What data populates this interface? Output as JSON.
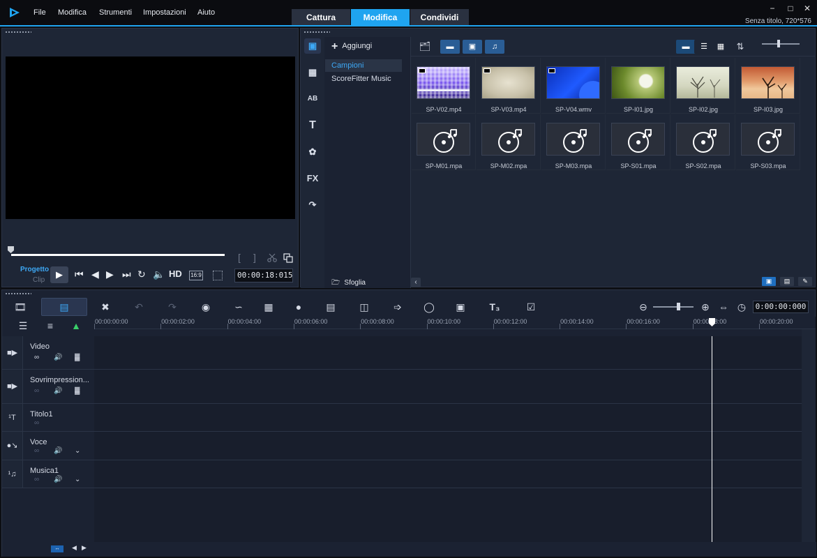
{
  "menu": {
    "items": [
      "File",
      "Modifica",
      "Strumenti",
      "Impostazioni",
      "Aiuto"
    ]
  },
  "tabs": [
    {
      "label": "Cattura",
      "active": false
    },
    {
      "label": "Modifica",
      "active": true
    },
    {
      "label": "Condividi",
      "active": false
    }
  ],
  "window": {
    "minimize": "−",
    "maximize": "□",
    "close": "✕",
    "project_title": "Senza titolo, 720*576"
  },
  "preview": {
    "mode_project": "Progetto",
    "mode_clip": "Clip",
    "timecode": "00:00:18:015",
    "hd_label": "HD",
    "aspect_label": "16:9",
    "mark_in": "[",
    "mark_out": "]"
  },
  "library": {
    "add_label": "Aggiungi",
    "folders": [
      {
        "label": "Campioni",
        "active": true
      },
      {
        "label": "ScoreFitter Music",
        "active": false
      }
    ],
    "browse_label": "Sfoglia",
    "sidebar_icons": [
      "media-icon",
      "instant-project-icon",
      "transition-icon",
      "title-icon",
      "graphics-icon",
      "fx-icon",
      "path-icon"
    ],
    "items": [
      {
        "name": "SP-V02.mp4",
        "kind": "video",
        "thumb": "purple-tiles"
      },
      {
        "name": "SP-V03.mp4",
        "kind": "video",
        "thumb": "beige"
      },
      {
        "name": "SP-V04.wmv",
        "kind": "video",
        "thumb": "blue"
      },
      {
        "name": "SP-I01.jpg",
        "kind": "image",
        "thumb": "dandelion"
      },
      {
        "name": "SP-I02.jpg",
        "kind": "image",
        "thumb": "trees"
      },
      {
        "name": "SP-I03.jpg",
        "kind": "image",
        "thumb": "desert"
      },
      {
        "name": "SP-M01.mpa",
        "kind": "audio",
        "thumb": "audio"
      },
      {
        "name": "SP-M02.mpa",
        "kind": "audio",
        "thumb": "audio"
      },
      {
        "name": "SP-M03.mpa",
        "kind": "audio",
        "thumb": "audio"
      },
      {
        "name": "SP-S01.mpa",
        "kind": "audio",
        "thumb": "audio"
      },
      {
        "name": "SP-S02.mpa",
        "kind": "audio",
        "thumb": "audio"
      },
      {
        "name": "SP-S03.mpa",
        "kind": "audio",
        "thumb": "audio"
      }
    ]
  },
  "timeline": {
    "timecode": "0:00:00:000",
    "ruler_labels": [
      "00:00:00:00",
      "00:00:02:00",
      "00:00:04:00",
      "00:00:06:00",
      "00:00:08:00",
      "00:00:10:00",
      "00:00:12:00",
      "00:00:14:00",
      "00:00:16:00",
      "00:00:18:00",
      "00:00:20:00"
    ],
    "tracks": [
      {
        "name": "Video",
        "icon": "video-track-icon"
      },
      {
        "name": "Sovrimpression...",
        "icon": "overlay-track-icon"
      },
      {
        "name": "Titolo1",
        "icon": "title-track-icon"
      },
      {
        "name": "Voce",
        "icon": "voice-track-icon"
      },
      {
        "name": "Musica1",
        "icon": "music-track-icon"
      }
    ]
  },
  "colors": {
    "accent": "#1fa4f0",
    "panel": "#1e2636",
    "background": "#0d0f14"
  }
}
